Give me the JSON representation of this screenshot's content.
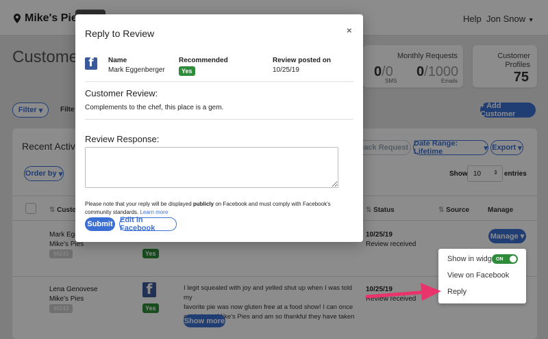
{
  "app": {
    "location": "Mike's Pies",
    "help": "Help",
    "user": "Jon Snow",
    "page_title": "Customer A",
    "stats": {
      "monthly_requests_label": "Monthly Requests",
      "sms_value": "0",
      "sms_total": "0",
      "sms_label": "SMS",
      "emails_value": "0",
      "emails_total": "1000",
      "emails_label": "Emails",
      "profiles_label": "Customer Profiles",
      "profiles_value": "75"
    },
    "filter_button": "Filter",
    "filter_text": "Filte",
    "add_customer": "+ Add Customer",
    "recent_activity": "Recent Activit",
    "feedback_request": "dback Request",
    "date_range": "Date Range: Lifetime",
    "export": "Export",
    "order_by": "Order by",
    "show": "Show",
    "entries_value": "10",
    "entries": "entries",
    "columns": {
      "customer": "Custo",
      "status": "Status",
      "source": "Source",
      "manage": "Manage"
    },
    "rows": [
      {
        "name": "Mark Egg",
        "business": "Mike's Pies",
        "id": "66243",
        "recommended": "Yes",
        "date": "10/25/19",
        "status": "Review received",
        "manage": "Manage"
      },
      {
        "name": "Lena Genovese",
        "business": "Mike's Pies",
        "id": "66243",
        "recommended": "Yes",
        "review_lines": [
          "I legit squealed with joy and yelled shut up when I was told my",
          "favorite pie was now gluten free at a food show! I can once",
          "again have Mike's Pies and am so thankful they have taken"
        ],
        "show_more": "Show more",
        "date": "10/25/19",
        "status": "Review received"
      }
    ],
    "dropdown": {
      "show_in_widget": "Show in widget",
      "toggle_state": "ON",
      "view_on_facebook": "View on Facebook",
      "reply": "Reply"
    }
  },
  "modal": {
    "title": "Reply to Review",
    "close": "×",
    "name_label": "Name",
    "name_value": "Mark Eggenberger",
    "recommended_label": "Recommended",
    "recommended_value": "Yes",
    "posted_label": "Review posted on",
    "posted_value": "10/25/19",
    "customer_review_heading": "Customer Review:",
    "customer_review_text": "Complements to the chef, this place is a gem.",
    "review_response_heading": "Review Response:",
    "response_value": "",
    "note_before": "Please note that your reply will be displayed ",
    "note_bold": "publicly",
    "note_after": " on Facebook and must comply with Facebook's community standards. ",
    "learn_more": "Learn more",
    "submit": "Submit",
    "edit_in_facebook": "Edit in Facebook"
  },
  "colors": {
    "accent": "#3b6fd4",
    "success": "#2e8b3a",
    "facebook": "#3b5998",
    "arrow": "#e8336b"
  },
  "icons": [
    "map-pin-icon",
    "chevron-down-icon",
    "facebook-icon",
    "close-icon",
    "sort-icon",
    "arrow-annotation-icon"
  ]
}
